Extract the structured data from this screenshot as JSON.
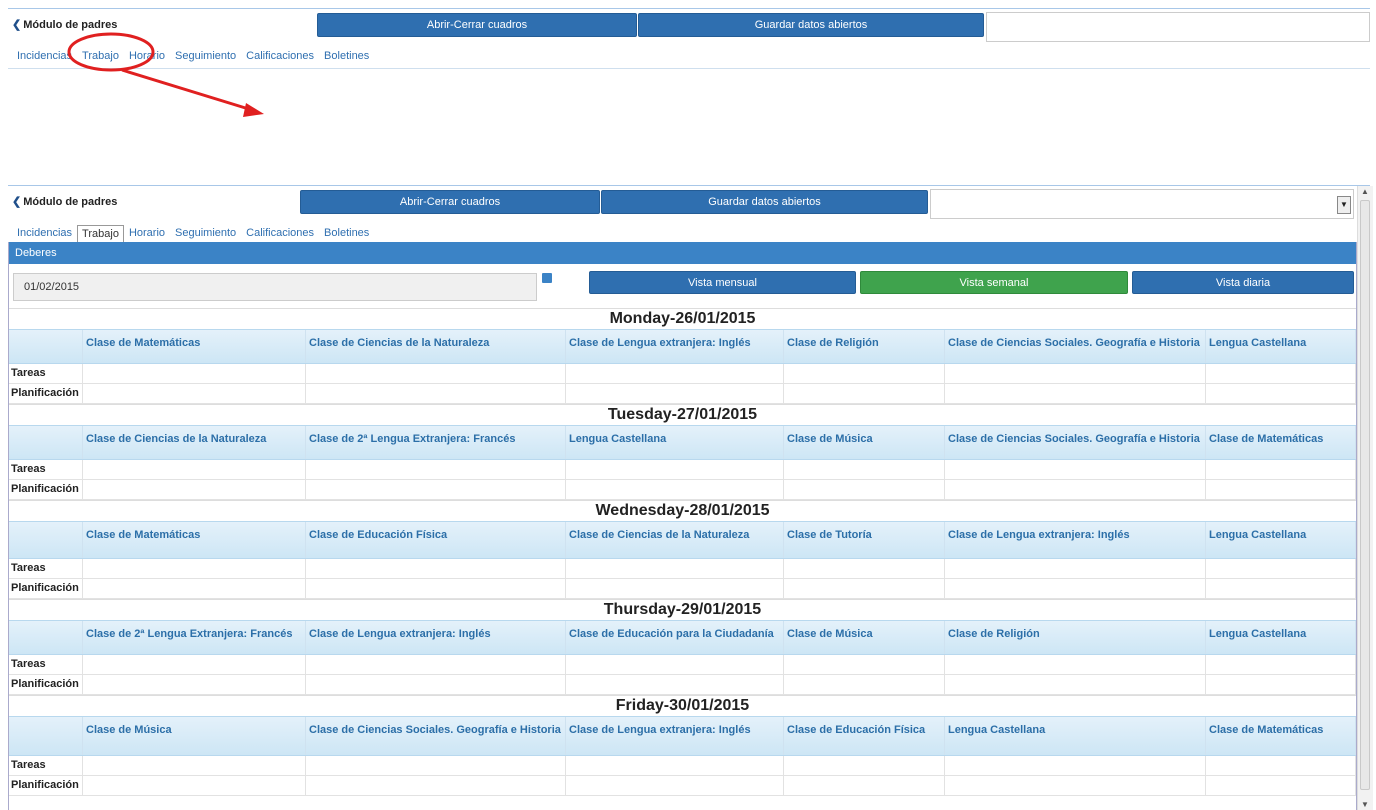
{
  "header": {
    "title": "Módulo de padres",
    "btn_toggle": "Abrir-Cerrar cuadros",
    "btn_save": "Guardar datos abiertos"
  },
  "tabs": [
    "Incidencias",
    "Trabajo",
    "Horario",
    "Seguimiento",
    "Calificaciones",
    "Boletines"
  ],
  "active_tab_index": 1,
  "annotation": {
    "color": "#e02020"
  },
  "panel": {
    "title": "Deberes",
    "date": "01/02/2015",
    "view_monthly": "Vista mensual",
    "view_weekly": "Vista semanal",
    "view_daily": "Vista diaria",
    "active_view": "Vista semanal"
  },
  "row_labels": {
    "tasks": "Tareas",
    "planning": "Planificación"
  },
  "days": [
    {
      "title": "Monday-26/01/2015",
      "subjects": [
        "Clase de Matemáticas",
        "Clase de Ciencias de la Naturaleza",
        "Clase de Lengua extranjera: Inglés",
        "Clase de Religión",
        "Clase de Ciencias Sociales. Geografía e Historia",
        "Lengua Castellana"
      ]
    },
    {
      "title": "Tuesday-27/01/2015",
      "subjects": [
        "Clase de Ciencias de la Naturaleza",
        "Clase de 2ª Lengua Extranjera: Francés",
        "Lengua Castellana",
        "Clase de Música",
        "Clase de Ciencias Sociales. Geografía e Historia",
        "Clase de Matemáticas"
      ]
    },
    {
      "title": "Wednesday-28/01/2015",
      "subjects": [
        "Clase de Matemáticas",
        "Clase de Educación Física",
        "Clase de Ciencias de la Naturaleza",
        "Clase de Tutoría",
        "Clase de Lengua extranjera: Inglés",
        "Lengua Castellana"
      ]
    },
    {
      "title": "Thursday-29/01/2015",
      "subjects": [
        "Clase de 2ª Lengua Extranjera: Francés",
        "Clase de Lengua extranjera: Inglés",
        "Clase de Educación para la Ciudadanía",
        "Clase de Música",
        "Clase de Religión",
        "Lengua Castellana"
      ]
    },
    {
      "title": "Friday-30/01/2015",
      "subjects": [
        "Clase de Música",
        "Clase de Ciencias Sociales. Geografía e Historia",
        "Clase de Lengua extranjera: Inglés",
        "Clase de Educación Física",
        "Lengua Castellana",
        "Clase de Matemáticas"
      ]
    }
  ]
}
